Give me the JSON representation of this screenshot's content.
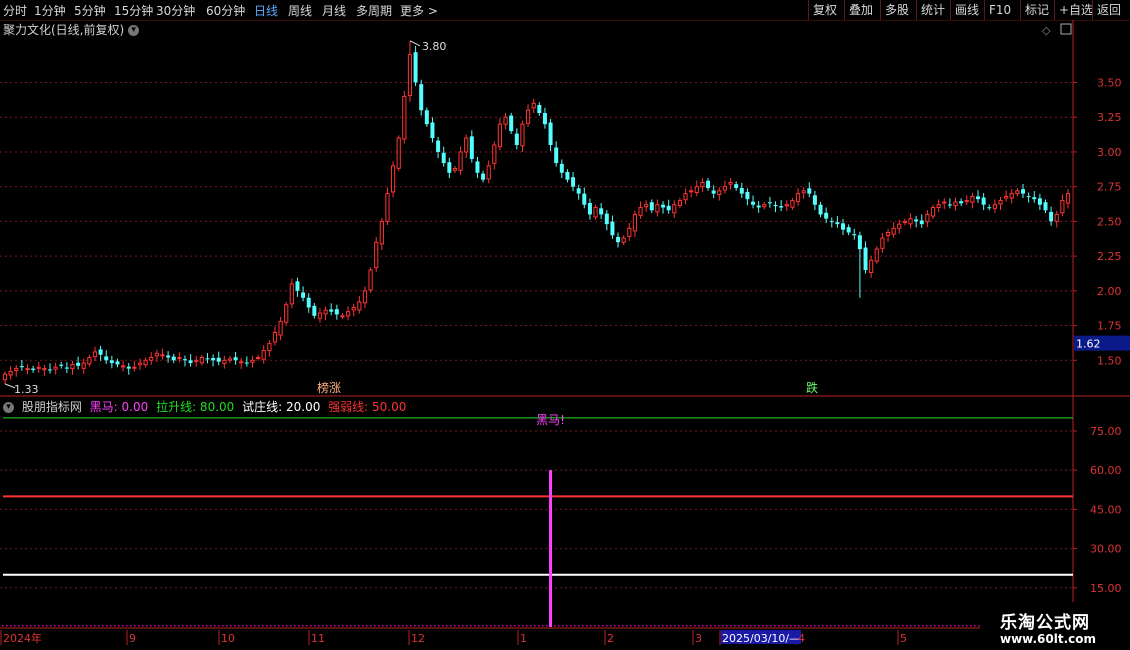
{
  "toolbar": {
    "periods": [
      "分时",
      "1分钟",
      "5分钟",
      "15分钟",
      "30分钟",
      "60分钟",
      "日线",
      "周线",
      "月线",
      "多周期",
      "更多 >"
    ],
    "active_period": "日线",
    "buttons": [
      "复权",
      "叠加",
      "多股",
      "统计",
      "画线",
      "F10",
      "标记",
      "+自选",
      "返回"
    ]
  },
  "chart_title": "聚力文化(日线,前复权)",
  "price_axis": [
    "3.50",
    "3.25",
    "3.00",
    "2.75",
    "2.50",
    "2.25",
    "2.00",
    "1.75",
    "1.50"
  ],
  "current_price_label": "1.62",
  "high_label": "3.80",
  "low_label": "1.33",
  "markers": {
    "top": "榜涨",
    "bottom": "跌"
  },
  "indicator": {
    "name": "股朋指标网",
    "items": [
      {
        "label": "黑马: 0.00",
        "color": "#ff44ff"
      },
      {
        "label": "拉升线: 80.00",
        "color": "#22dd22"
      },
      {
        "label": "试庄线: 20.00",
        "color": "#ffffff"
      },
      {
        "label": "强弱线: 50.00",
        "color": "#ff3333"
      }
    ],
    "signal_label": "黑马!",
    "axis": [
      "75.00",
      "60.00",
      "45.00",
      "30.00",
      "15.00"
    ]
  },
  "date_axis": [
    "2024年",
    "9",
    "10",
    "11",
    "12",
    "1",
    "2",
    "3",
    "2025/03/10/—",
    "4",
    "5"
  ],
  "watermark": {
    "title": "乐淘公式网",
    "url": "www.60lt.com"
  },
  "colors": {
    "up": "#ff3333",
    "down": "#54ffff",
    "grid": "#7a1a1a",
    "accent": "#5fa9ff"
  },
  "chart_data": {
    "type": "candlestick",
    "title": "聚力文化(日线,前复权)",
    "ylim": [
      1.25,
      3.95
    ],
    "high": 3.8,
    "low": 1.33,
    "close_series": [
      1.4,
      1.42,
      1.44,
      1.45,
      1.44,
      1.43,
      1.45,
      1.44,
      1.43,
      1.45,
      1.46,
      1.44,
      1.47,
      1.46,
      1.48,
      1.52,
      1.56,
      1.54,
      1.5,
      1.48,
      1.47,
      1.46,
      1.44,
      1.45,
      1.48,
      1.5,
      1.52,
      1.55,
      1.54,
      1.52,
      1.5,
      1.52,
      1.5,
      1.48,
      1.5,
      1.52,
      1.51,
      1.5,
      1.49,
      1.5,
      1.51,
      1.5,
      1.49,
      1.48,
      1.5,
      1.52,
      1.57,
      1.62,
      1.7,
      1.78,
      1.9,
      2.05,
      2.0,
      1.95,
      1.88,
      1.82,
      1.84,
      1.86,
      1.85,
      1.83,
      1.82,
      1.85,
      1.88,
      1.92,
      2.0,
      2.15,
      2.35,
      2.5,
      2.7,
      2.9,
      3.1,
      3.4,
      3.7,
      3.5,
      3.3,
      3.2,
      3.1,
      3.0,
      2.92,
      2.85,
      2.88,
      3.0,
      3.1,
      2.95,
      2.85,
      2.8,
      2.9,
      3.05,
      3.2,
      3.25,
      3.15,
      3.05,
      3.2,
      3.3,
      3.35,
      3.28,
      3.2,
      3.05,
      2.92,
      2.85,
      2.8,
      2.75,
      2.7,
      2.62,
      2.55,
      2.6,
      2.55,
      2.48,
      2.4,
      2.35,
      2.38,
      2.45,
      2.55,
      2.6,
      2.62,
      2.58,
      2.62,
      2.6,
      2.58,
      2.62,
      2.65,
      2.7,
      2.72,
      2.75,
      2.78,
      2.74,
      2.7,
      2.72,
      2.75,
      2.78,
      2.74,
      2.7,
      2.66,
      2.62,
      2.6,
      2.62,
      2.63,
      2.61,
      2.6,
      2.62,
      2.65,
      2.7,
      2.72,
      2.7,
      2.62,
      2.55,
      2.52,
      2.5,
      2.48,
      2.44,
      2.42,
      2.4,
      2.3,
      2.15,
      2.22,
      2.3,
      2.38,
      2.42,
      2.45,
      2.48,
      2.5,
      2.52,
      2.5,
      2.48,
      2.55,
      2.6,
      2.62,
      2.64,
      2.62,
      2.64,
      2.63,
      2.65,
      2.68,
      2.66,
      2.62,
      2.6,
      2.62,
      2.65,
      2.68,
      2.7,
      2.72,
      2.7,
      2.68,
      2.66,
      2.62,
      2.58,
      2.5,
      2.55,
      2.65,
      2.7
    ],
    "indicator_series": [
      {
        "name": "拉升线",
        "value": 80,
        "color": "#22dd22"
      },
      {
        "name": "强弱线",
        "value": 50,
        "color": "#ff3333"
      },
      {
        "name": "试庄线",
        "value": 20,
        "color": "#ffffff"
      },
      {
        "name": "黑马",
        "signal_index": 97,
        "value": 60,
        "color": "#ff44ff"
      }
    ],
    "indicator_ylim": [
      0,
      88
    ]
  }
}
